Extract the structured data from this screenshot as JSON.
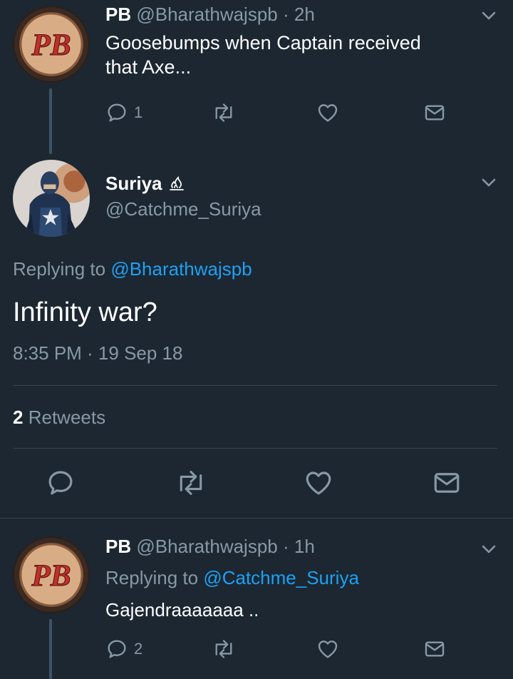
{
  "tweets": [
    {
      "name": "PB",
      "handle": "@Bharathwajspb",
      "time": "· 2h",
      "text_line1": "Goosebumps when Captain received",
      "text_line2": "that Axe...",
      "reply_count": "1"
    },
    {
      "name": "Suriya",
      "handle": "@Catchme_Suriya",
      "replying_prefix": "Replying to",
      "replying_handle": "@Bharathwajspb",
      "text": "Infinity war?",
      "timestamp": "8:35 PM · 19 Sep 18",
      "retweet_count": "2",
      "retweet_label": "Retweets"
    },
    {
      "name": "PB",
      "handle": "@Bharathwajspb",
      "time": "· 1h",
      "replying_prefix": "Replying to",
      "replying_handle": "@Catchme_Suriya",
      "text": "Gajendraaaaaaa ..",
      "reply_count": "2"
    }
  ],
  "avatar_text": "PB",
  "colors": {
    "background": "#1c2732",
    "muted": "#8899a6",
    "link": "#1da1f2",
    "divider": "#38444d"
  },
  "icons": [
    "chevron-down-icon",
    "reply-icon",
    "retweet-icon",
    "like-icon",
    "dm-icon",
    "flame-icon"
  ]
}
